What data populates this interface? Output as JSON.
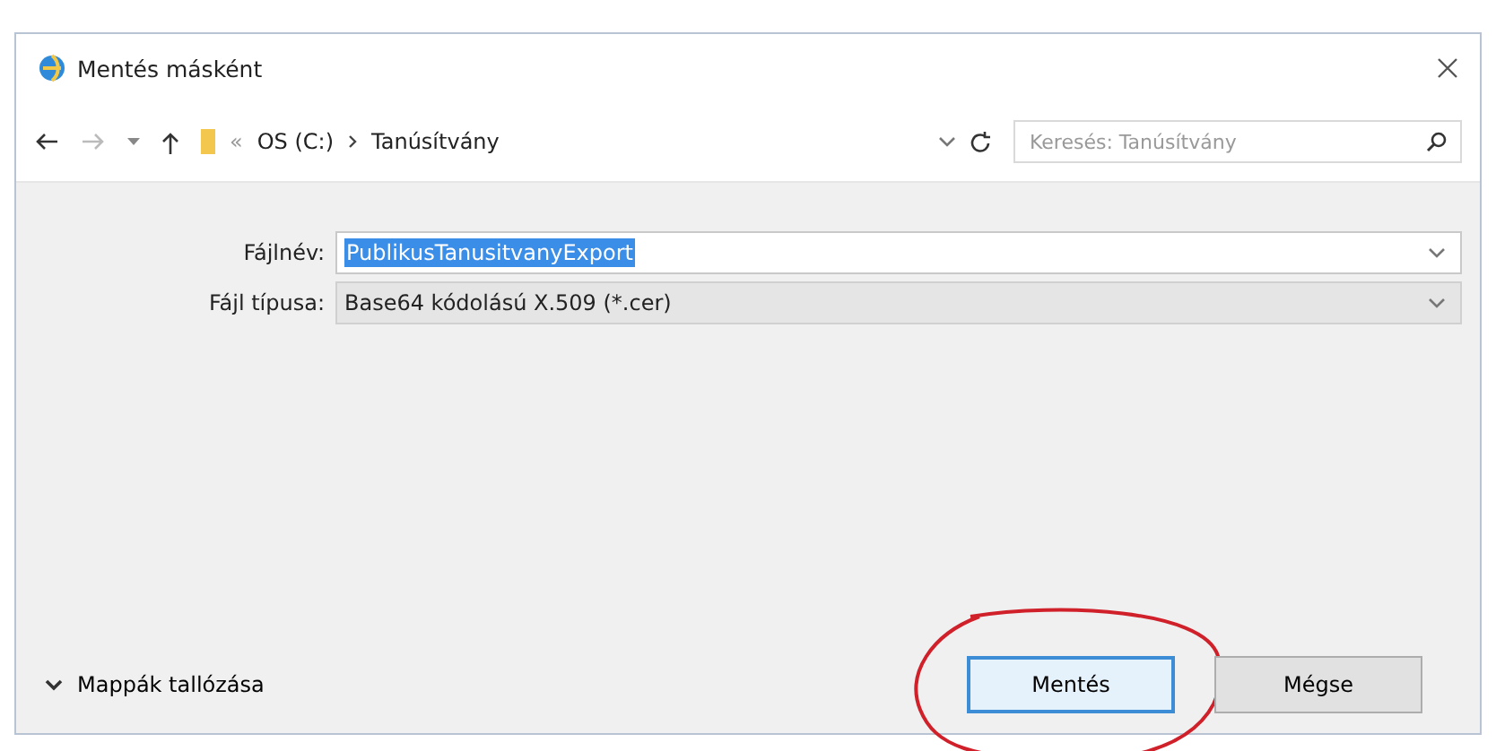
{
  "window": {
    "title": "Mentés másként"
  },
  "nav": {
    "path": [
      {
        "label": "OS (C:)"
      },
      {
        "label": "Tanúsítvány"
      }
    ],
    "overflow": "«",
    "search": {
      "placeholder": "Keresés: Tanúsítvány"
    }
  },
  "fields": [
    {
      "label": "Fájlnév:",
      "value": "PublikusTanusitvanyExport",
      "kind": "editable",
      "text_selected": true
    },
    {
      "label": "Fájl típusa:",
      "value": "Base64 kódolású X.509 (*.cer)",
      "kind": "dropdown",
      "text_selected": false
    }
  ],
  "browse_folders": {
    "label": "Mappák tallózása",
    "expanded": false
  },
  "buttons": [
    {
      "label": "Mentés",
      "default": true,
      "circled": true
    },
    {
      "label": "Mégse",
      "default": false,
      "circled": false
    }
  ]
}
